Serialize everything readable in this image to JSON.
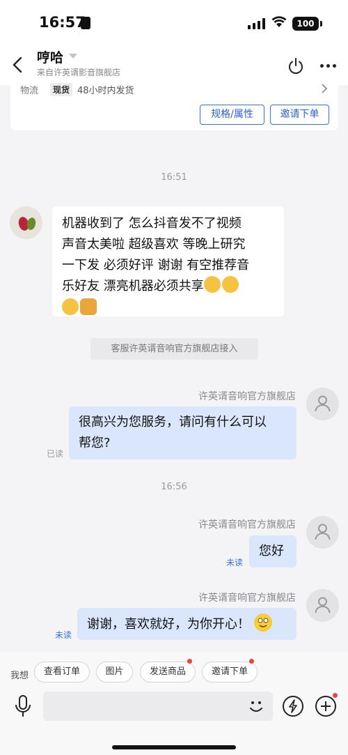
{
  "status_bar": {
    "time": "16:57",
    "battery": "100"
  },
  "header": {
    "title": "哼哈",
    "subtitle": "来自许英谞影音旗舰店"
  },
  "product_card": {
    "logistics_label": "物流",
    "stock_badge": "现货",
    "ship_text": "48小时内发货",
    "spec_button": "规格/属性",
    "order_button": "邀请下单"
  },
  "timestamps": [
    "16:51",
    "16:56"
  ],
  "messages": {
    "user_message": {
      "lines": [
        "机器收到了 怎么抖音发不了视频",
        "声音太美啦 超级喜欢 等晚上研究",
        "一下发 必须好评  谢谢 有空推荐音",
        "乐好友 漂亮机器必须共享"
      ],
      "emojis": [
        "clap",
        "clap",
        "clap",
        "thumbs-up"
      ]
    },
    "system_notice": "客服许英谞音响官方旗舰店接入",
    "service_name": "许英谞音响官方旗舰店",
    "service_1": {
      "lines": [
        "很高兴为您服务，请问有什么可以",
        "帮您?"
      ],
      "status": "已读"
    },
    "service_2": {
      "text": "您好",
      "status": "未读"
    },
    "service_3": {
      "text": "谢谢，喜欢就好，为你开心！",
      "emoji": "smile",
      "status": "未读"
    }
  },
  "bottom_bar": {
    "quick_label": "我想",
    "chips": [
      "查看订单",
      "图片",
      "发送商品",
      "邀请下单"
    ],
    "chip_badges": [
      false,
      false,
      true,
      true
    ]
  },
  "colors": {
    "accent": "#3b6fdc",
    "bubble_right": "#d9e6fb",
    "badge": "#f04040"
  }
}
